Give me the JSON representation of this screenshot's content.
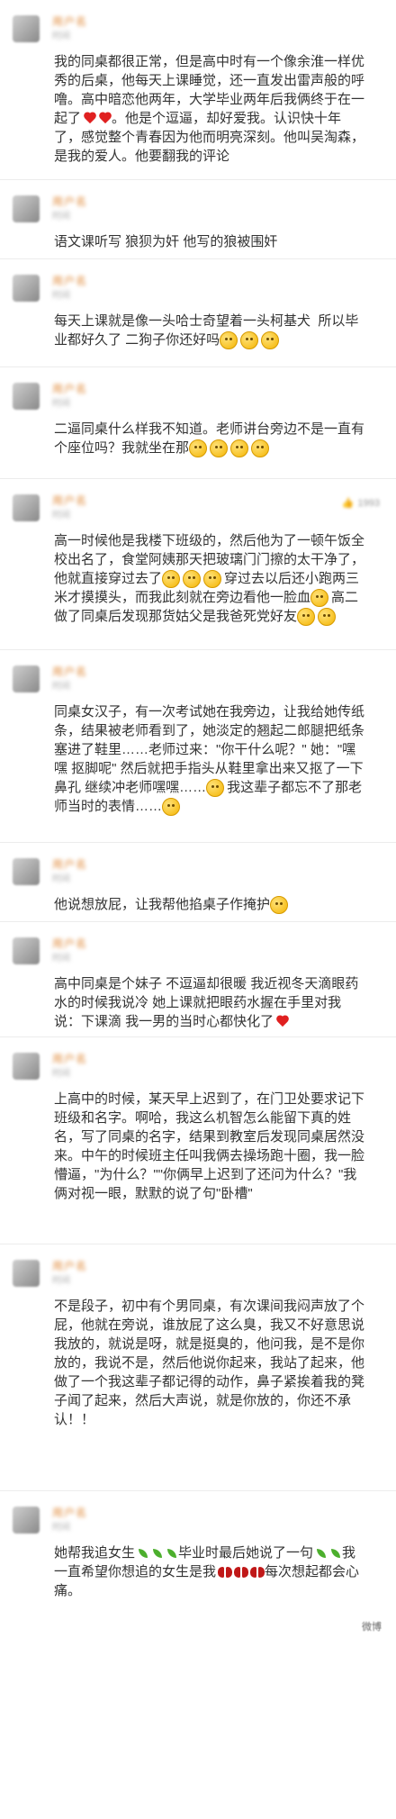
{
  "comments": [
    {
      "username": "用户名",
      "time": "时间",
      "text": "我的同桌都很正常，但是高中时有一个像余淮一样优秀的后桌，他每天上课睡觉，还一直发出雷声般的呼噜。高中暗恋他两年，大学毕业两年后我俩终于在一起了",
      "tail": "。他是个逗逼，却好爱我。认识快十年了，感觉整个青春因为他而明亮深刻。他叫吴淘森，是我的爱人。他要翻我的评论"
    },
    {
      "username": "用户名",
      "time": "时间",
      "text": "语文课听写 狼狈为奸 他写的狼被围奸"
    },
    {
      "username": "用户名",
      "time": "时间",
      "text": "每天上课就是像一头哈士奇望着一头柯基犬  所以毕业都好久了 二狗子你还好吗"
    },
    {
      "username": "用户名",
      "time": "时间",
      "text": "二逼同桌什么样我不知道。老师讲台旁边不是一直有个座位吗？我就坐在那"
    },
    {
      "username": "用户名",
      "time": "时间",
      "like_count": "1993",
      "text": "高一时候他是我楼下班级的，然后他为了一顿午饭全校出名了，食堂阿姨那天把玻璃门门擦的太干净了，他就直接穿过去了",
      "mid": "穿过去以后还小跑两三米才摸摸头，而我此刻就在旁边看他一脸血",
      "end": "高二做了同桌后发现那货姑父是我爸死党好友"
    },
    {
      "username": "用户名",
      "time": "时间",
      "text": "同桌女汉子，有一次考试她在我旁边，让我给她传纸条，结果被老师看到了，她淡定的翘起二郎腿把纸条塞进了鞋里……老师过来：\"你干什么呢？\" 她：\"嘿嘿 抠脚呢\" 然后就把手指头从鞋里拿出来又抠了一下鼻孔 继续冲老师嘿嘿……",
      "end": "我这辈子都忘不了那老师当时的表情……"
    },
    {
      "username": "用户名",
      "time": "时间",
      "text": "他说想放屁，让我帮他掐桌子作掩护"
    },
    {
      "username": "用户名",
      "time": "时间",
      "text": "高中同桌是个妹子 不逗逼却很暖 我近视冬天滴眼药水的时候我说冷 她上课就把眼药水握在手里对我说：下课滴 我一男的当时心都快化了"
    },
    {
      "username": "用户名",
      "time": "时间",
      "text": "上高中的时候，某天早上迟到了，在门卫处要求记下班级和名字。啊哈，我这么机智怎么能留下真的姓名，写了同桌的名字，结果到教室后发现同桌居然没来。中午的时候班主任叫我俩去操场跑十圈，我一脸懵逼，\"为什么？\"\"你俩早上迟到了还问为什么？\"我俩对视一眼，默默的说了句\"卧槽\""
    },
    {
      "username": "用户名",
      "time": "时间",
      "text": "不是段子，初中有个男同桌，有次课间我闷声放了个屁，他就在旁说，谁放屁了这么臭，我又不好意思说我放的，就说是呀，就是挺臭的，他问我，是不是你放的，我说不是，然后他说你起来，我站了起来，他做了一个我这辈子都记得的动作，鼻子紧挨着我的凳子闻了起来，然后大声说，就是你放的，你还不承认！！"
    },
    {
      "username": "用户名",
      "time": "时间",
      "text": "她帮我追女生",
      "mid": "毕业时最后她说了一句",
      "end": "我一直希望你想追的女生是我",
      "tail": "每次想起都会心痛。"
    }
  ],
  "watermark": "微博"
}
